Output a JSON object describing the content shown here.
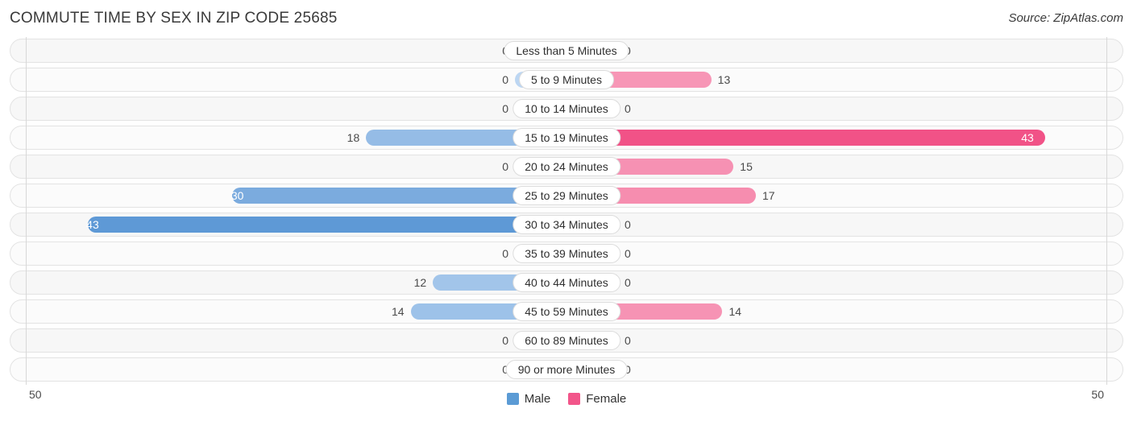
{
  "header": {
    "title": "COMMUTE TIME BY SEX IN ZIP CODE 25685",
    "source": "Source: ZipAtlas.com"
  },
  "legend": {
    "male_label": "Male",
    "female_label": "Female",
    "male_color": "#5b9bd5",
    "female_color": "#f2558a"
  },
  "axis": {
    "left_tick": "50",
    "right_tick": "50",
    "max": 50
  },
  "chart_data": {
    "type": "bar",
    "orientation": "horizontal-diverging",
    "title": "COMMUTE TIME BY SEX IN ZIP CODE 25685",
    "xlabel": "",
    "ylabel": "",
    "xlim": [
      50,
      50
    ],
    "grid": false,
    "legend_position": "bottom-center",
    "categories": [
      "Less than 5 Minutes",
      "5 to 9 Minutes",
      "10 to 14 Minutes",
      "15 to 19 Minutes",
      "20 to 24 Minutes",
      "25 to 29 Minutes",
      "30 to 34 Minutes",
      "35 to 39 Minutes",
      "40 to 44 Minutes",
      "45 to 59 Minutes",
      "60 to 89 Minutes",
      "90 or more Minutes"
    ],
    "series": [
      {
        "name": "Male",
        "values": [
          0,
          0,
          0,
          18,
          0,
          30,
          43,
          0,
          12,
          14,
          0,
          0
        ]
      },
      {
        "name": "Female",
        "values": [
          0,
          13,
          0,
          43,
          15,
          17,
          0,
          0,
          0,
          14,
          0,
          0
        ]
      }
    ]
  },
  "rows": [
    {
      "label": "Less than 5 Minutes",
      "male": "0",
      "female": "0"
    },
    {
      "label": "5 to 9 Minutes",
      "male": "0",
      "female": "13"
    },
    {
      "label": "10 to 14 Minutes",
      "male": "0",
      "female": "0"
    },
    {
      "label": "15 to 19 Minutes",
      "male": "18",
      "female": "43"
    },
    {
      "label": "20 to 24 Minutes",
      "male": "0",
      "female": "15"
    },
    {
      "label": "25 to 29 Minutes",
      "male": "30",
      "female": "17"
    },
    {
      "label": "30 to 34 Minutes",
      "male": "43",
      "female": "0"
    },
    {
      "label": "35 to 39 Minutes",
      "male": "0",
      "female": "0"
    },
    {
      "label": "40 to 44 Minutes",
      "male": "12",
      "female": "0"
    },
    {
      "label": "45 to 59 Minutes",
      "male": "14",
      "female": "14"
    },
    {
      "label": "60 to 89 Minutes",
      "male": "0",
      "female": "0"
    },
    {
      "label": "90 or more Minutes",
      "male": "0",
      "female": "0"
    }
  ]
}
